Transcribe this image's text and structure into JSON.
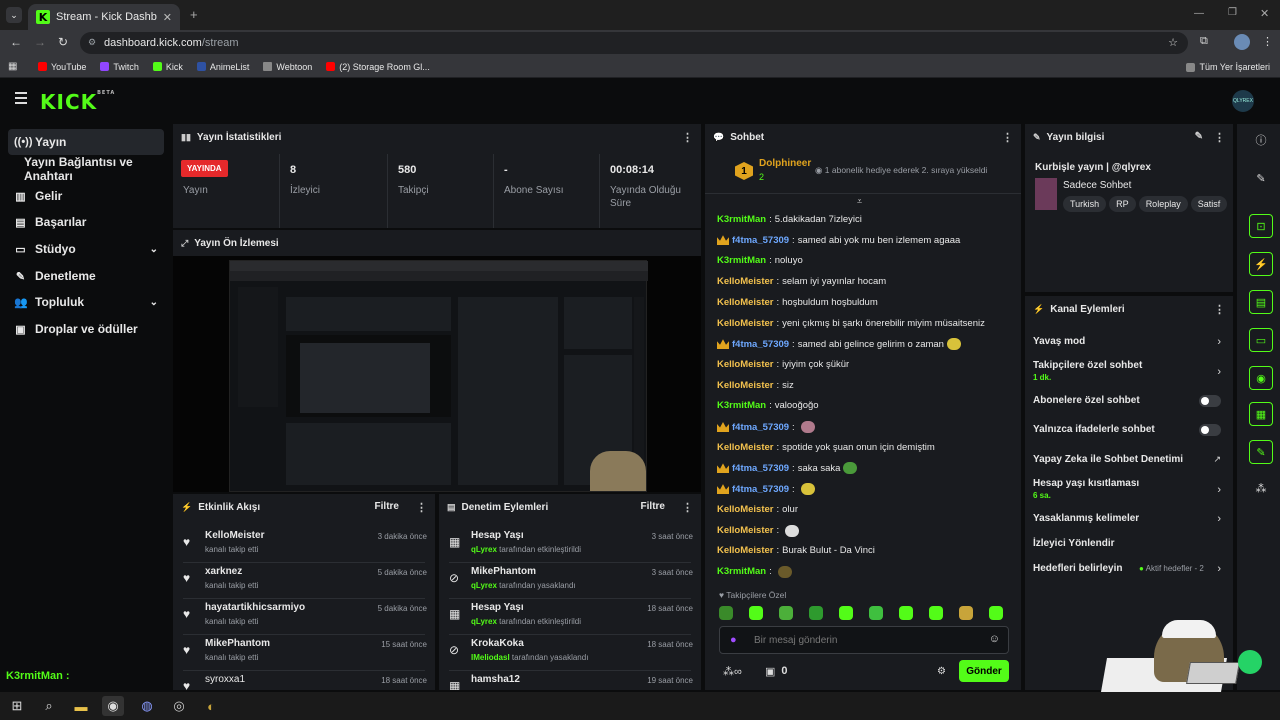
{
  "browser": {
    "tab_title": "Stream - Kick Dashboard",
    "url_host": "dashboard.kick.com",
    "url_path": "/stream",
    "bookmarks": [
      {
        "label": "YouTube",
        "color": "#ff0000"
      },
      {
        "label": "Twitch",
        "color": "#9146ff"
      },
      {
        "label": "Kick",
        "color": "#53fc18"
      },
      {
        "label": "AnimeList",
        "color": "#2e51a2"
      },
      {
        "label": "Webtoon",
        "color": "#888888"
      },
      {
        "label": "(2) Storage Room Gl...",
        "color": "#ff0000"
      }
    ],
    "all_bookmarks": "Tüm Yer İşaretleri"
  },
  "kick": {
    "logo": "KICK",
    "beta": "BETA",
    "avatar_text": "QLYREX"
  },
  "sidebar": {
    "items": [
      {
        "label": "Yayın",
        "icon": "broadcast-icon"
      },
      {
        "label": "Yayın Bağlantısı ve Anahtarı"
      },
      {
        "label": "Gelir",
        "icon": "income-icon"
      },
      {
        "label": "Başarılar",
        "icon": "achievements-icon"
      },
      {
        "label": "Stüdyo",
        "icon": "studio-icon"
      },
      {
        "label": "Denetleme",
        "icon": "wrench-icon"
      },
      {
        "label": "Topluluk",
        "icon": "community-icon"
      },
      {
        "label": "Droplar ve ödüller",
        "icon": "gift-icon"
      }
    ]
  },
  "stats": {
    "title": "Yayın İstatistikleri",
    "live_badge": "YAYINDA",
    "live_label": "Yayın",
    "viewers_value": "8",
    "viewers_label": "İzleyici",
    "followers_value": "580",
    "followers_label": "Takipçi",
    "subs_value": "-",
    "subs_label": "Abone Sayısı",
    "duration_value": "00:08:14",
    "duration_label": "Yayında Olduğu Süre"
  },
  "preview": {
    "title": "Yayın Ön İzlemesi"
  },
  "activity": {
    "title": "Etkinlik Akışı",
    "filter": "Filtre",
    "items": [
      {
        "name": "KelloMeister",
        "sub": "kanalı takip etti",
        "time": "3 dakika önce"
      },
      {
        "name": "xarknez",
        "sub": "kanalı takip etti",
        "time": "5 dakika önce"
      },
      {
        "name": "hayatartikhicsarmiyo",
        "sub": "kanalı takip etti",
        "time": "5 dakika önce"
      },
      {
        "name": "MikePhantom",
        "sub": "kanalı takip etti",
        "time": "15 saat önce"
      },
      {
        "name": "syroxxa1",
        "sub": "",
        "time": "18 saat önce"
      }
    ]
  },
  "moderation": {
    "title": "Denetim Eylemleri",
    "filter": "Filtre",
    "items": [
      {
        "name": "Hesap Yaşı",
        "actor": "qLyrex",
        "action": "tarafından etkinleştirildi",
        "time": "3 saat önce"
      },
      {
        "name": "MikePhantom",
        "actor": "qLyrex",
        "action": "tarafından yasaklandı",
        "time": "3 saat önce"
      },
      {
        "name": "Hesap Yaşı",
        "actor": "qLyrex",
        "action": "tarafından etkinleştirildi",
        "time": "18 saat önce"
      },
      {
        "name": "KrokaKoka",
        "actor": "IMeliodasl",
        "action": "tarafından yasaklandı",
        "time": "18 saat önce"
      },
      {
        "name": "hamsha12",
        "actor": "",
        "action": "",
        "time": "19 saat önce"
      }
    ]
  },
  "chat": {
    "title": "Sohbet",
    "pinned_user": "Dolphineer",
    "pinned_rank": "1",
    "pinned_count": "2",
    "pinned_text": "1 abonelik hediye ederek 2. sıraya yükseldi",
    "messages": [
      {
        "user": "K3rmitMan",
        "text": "5.dakikadan 7izleyici",
        "color": "#53fc18",
        "crown": false,
        "emote": ""
      },
      {
        "user": "f4tma_57309",
        "text": "samed abi yok mu ben izlemem agaaa",
        "color": "#6ea8ff",
        "crown": true,
        "emote": ""
      },
      {
        "user": "K3rmitMan",
        "text": "noluyo",
        "color": "#53fc18",
        "crown": false,
        "emote": ""
      },
      {
        "user": "KelloMeister",
        "text": "selam iyi yayınlar hocam",
        "color": "#f2c14e",
        "crown": false,
        "emote": ""
      },
      {
        "user": "KelloMeister",
        "text": "hoşbuldum hoşbuldum",
        "color": "#f2c14e",
        "crown": false,
        "emote": ""
      },
      {
        "user": "KelloMeister",
        "text": "yeni çıkmış bi şarkı önerebilir miyim müsaitseniz",
        "color": "#f2c14e",
        "crown": false,
        "emote": ""
      },
      {
        "user": "f4tma_57309",
        "text": "samed abi gelince gelirim o zaman",
        "color": "#6ea8ff",
        "crown": true,
        "emote": "#d8c23a"
      },
      {
        "user": "KelloMeister",
        "text": "iyiyim çok şükür",
        "color": "#f2c14e",
        "crown": false,
        "emote": ""
      },
      {
        "user": "KelloMeister",
        "text": "siz",
        "color": "#f2c14e",
        "crown": false,
        "emote": ""
      },
      {
        "user": "K3rmitMan",
        "text": "valooğoğo",
        "color": "#53fc18",
        "crown": false,
        "emote": ""
      },
      {
        "user": "f4tma_57309",
        "text": "",
        "color": "#6ea8ff",
        "crown": true,
        "emote": "#b07a8c"
      },
      {
        "user": "KelloMeister",
        "text": "spotide yok şuan onun için demiştim",
        "color": "#f2c14e",
        "crown": false,
        "emote": ""
      },
      {
        "user": "f4tma_57309",
        "text": "saka saka",
        "color": "#6ea8ff",
        "crown": true,
        "emote": "#4a9a3a"
      },
      {
        "user": "f4tma_57309",
        "text": "",
        "color": "#6ea8ff",
        "crown": true,
        "emote": "#d8c23a"
      },
      {
        "user": "KelloMeister",
        "text": "olur",
        "color": "#f2c14e",
        "crown": false,
        "emote": ""
      },
      {
        "user": "KelloMeister",
        "text": "",
        "color": "#f2c14e",
        "crown": false,
        "emote": "#dddddd"
      },
      {
        "user": "KelloMeister",
        "text": "Burak Bulut - Da Vinci",
        "color": "#f2c14e",
        "crown": false,
        "emote": ""
      },
      {
        "user": "K3rmitMan",
        "text": "",
        "color": "#53fc18",
        "crown": false,
        "emote": "#6a5a2a"
      }
    ],
    "emote_section": "Takipçilere Özel",
    "input_placeholder": "Bir mesaj gönderin",
    "points": "0",
    "send": "Gönder"
  },
  "stream_info": {
    "title": "Yayın bilgisi",
    "stream_title": "Kurbişle yayın | @qlyrex",
    "category": "Sadece Sohbet",
    "tags": [
      "Turkish",
      "RP",
      "Roleplay",
      "Satisf"
    ]
  },
  "channel_actions": {
    "title": "Kanal Eylemleri",
    "rows": [
      {
        "label": "Yavaş mod",
        "sub": "",
        "control": "chevron"
      },
      {
        "label": "Takipçilere özel sohbet",
        "sub": "1 dk.",
        "control": "chevron"
      },
      {
        "label": "Abonelere özel sohbet",
        "sub": "",
        "control": "toggle"
      },
      {
        "label": "Yalnızca ifadelerle sohbet",
        "sub": "",
        "control": "toggle"
      },
      {
        "label": "Yapay Zeka ile Sohbet Denetimi",
        "sub": "",
        "control": "external"
      },
      {
        "label": "Hesap yaşı kısıtlaması",
        "sub": "6 sa.",
        "control": "chevron"
      },
      {
        "label": "Yasaklanmış kelimeler",
        "sub": "",
        "control": "chevron"
      },
      {
        "label": "İzleyici Yönlendir",
        "sub": "",
        "control": "none"
      },
      {
        "label": "Hedefleri belirleyin",
        "sub": "",
        "control": "chevron"
      }
    ],
    "goals_status": "Aktif hedefler - 2"
  },
  "overlay": {
    "user": "K3rmitMan :"
  }
}
